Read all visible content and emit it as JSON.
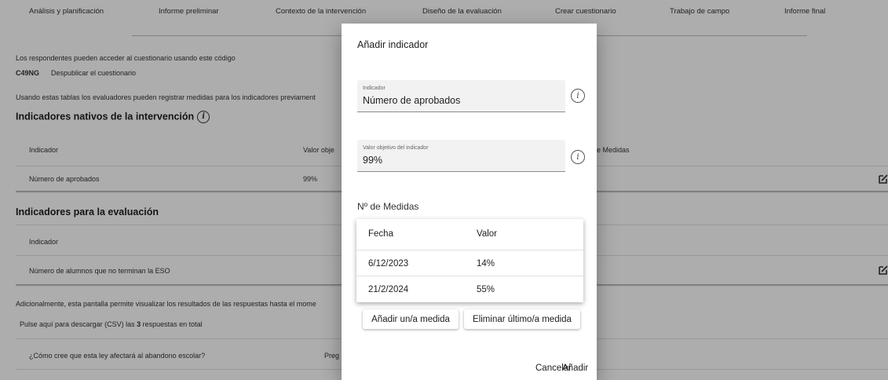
{
  "nav": {
    "tabs": [
      "Análisis y planificación",
      "Informe preliminar",
      "Contexto de la intervención",
      "Diseño de la evaluación",
      "Crear cuestionario",
      "Trabajo de campo",
      "Informe final"
    ]
  },
  "main": {
    "access_text": "Los respondentes pueden acceder al cuestionario usando este código",
    "code": "C49NG",
    "unpublish_link": "Despublicar el cuestionario",
    "tables_intro": "Usando estas tablas los evaluadores pueden registrar medidas para los indicadores previament",
    "native_title": "Indicadores nativos de la intervención",
    "native_headers": [
      "Indicador",
      "Valor obje",
      "e Medidas"
    ],
    "native_rows": [
      {
        "indicator": "Número de aprobados",
        "value": "99%"
      }
    ],
    "eval_title": "Indicadores para la evaluación",
    "eval_header": "Indicador",
    "eval_rows": [
      {
        "indicator": "Número de alumnos que no terminan la ESO"
      }
    ],
    "results_text": "Adicionalmente, esta pantalla permite visualizar los resultados de las respuestas hasta el mome",
    "download_prefix": "Pulse aquí para descargar (CSV) las ",
    "download_count": "3",
    "download_suffix": " respuestas en total",
    "question_rows": [
      {
        "question": "¿Cómo cree que esta ley afectará al abandono escolar?",
        "type": "Preg"
      }
    ]
  },
  "dialog": {
    "title": "Añadir indicador",
    "indicator_label": "Indicador",
    "indicator_value": "Número de aprobados",
    "target_label": "Valor objetivo del indicador",
    "target_value": "99%",
    "measures_title": "Nº de Medidas",
    "measures_headers": [
      "Fecha",
      "Valor"
    ],
    "measures": [
      {
        "date": "6/12/2023",
        "value": "14%"
      },
      {
        "date": "21/2/2024",
        "value": "55%"
      }
    ],
    "add_measure": "Añadir un/a medida",
    "remove_measure": "Eliminar último/a medida",
    "cancel": "Cancelar",
    "add": "Añadir"
  },
  "icons": {
    "info": "info-icon",
    "edit": "edit-icon"
  },
  "colors": {
    "overlay": "#000000",
    "dialog_bg": "#ffffff",
    "field_bg": "#f2f2f2"
  }
}
